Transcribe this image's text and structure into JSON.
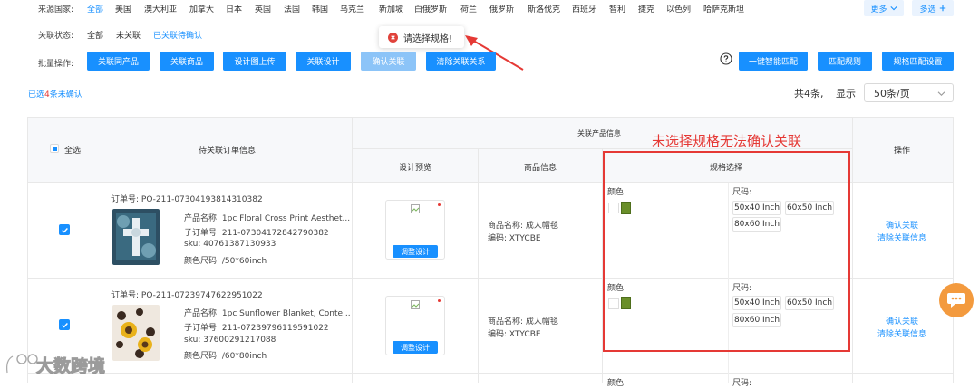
{
  "filters": {
    "country_label": "来源国家:",
    "countries": [
      {
        "label": "全部",
        "active": true
      },
      {
        "label": "美国",
        "active": false
      },
      {
        "label": "澳大利亚",
        "active": false
      },
      {
        "label": "加拿大",
        "active": false
      },
      {
        "label": "日本",
        "active": false
      },
      {
        "label": "英国",
        "active": false
      },
      {
        "label": "法国",
        "active": false
      },
      {
        "label": "韩国",
        "active": false
      },
      {
        "label": "乌克兰",
        "active": false
      },
      {
        "label": "新加坡",
        "active": false
      },
      {
        "label": "白俄罗斯",
        "active": false
      },
      {
        "label": "荷兰",
        "active": false
      },
      {
        "label": "俄罗斯",
        "active": false
      },
      {
        "label": "斯洛伐克",
        "active": false
      },
      {
        "label": "西班牙",
        "active": false
      },
      {
        "label": "智利",
        "active": false
      },
      {
        "label": "捷克",
        "active": false
      },
      {
        "label": "以色列",
        "active": false
      },
      {
        "label": "哈萨克斯坦",
        "active": false
      }
    ],
    "more_label": "更多",
    "multi_label": "多选",
    "status_label": "关联状态:",
    "statuses": [
      {
        "label": "全部",
        "active": false
      },
      {
        "label": "未关联",
        "active": false
      },
      {
        "label": "已关联待确认",
        "active": true
      }
    ]
  },
  "toast": {
    "message": "请选择规格!"
  },
  "batch": {
    "label": "批量操作:",
    "buttons": [
      "关联同产品",
      "关联商品",
      "设计图上传",
      "关联设计",
      "确认关联",
      "清除关联关系"
    ],
    "right_buttons": [
      "一键智能匹配",
      "匹配规则",
      "规格匹配设置"
    ]
  },
  "selection": {
    "prefix": "已选",
    "count": "4",
    "suffix": "条未确认"
  },
  "pagination": {
    "total_text": "共4条,",
    "display_label": "显示",
    "page_size": "50条/页"
  },
  "annotation": {
    "text": "未选择规格无法确认关联",
    "color": "#e53935"
  },
  "table": {
    "select_all": "全选",
    "col_order": "待关联订单信息",
    "col_related": "关联产品信息",
    "col_preview": "设计预览",
    "col_product": "商品信息",
    "col_spec": "规格选择",
    "col_ops": "操作",
    "rows": [
      {
        "order_no": "订单号: PO-211-07304193814310382",
        "product_name": "产品名称: 1pc Floral Cross Print Aesthet...",
        "sub_order": "子订单号: 211-07304172842790382",
        "sku": "sku: 40761387130933",
        "color_size": "颜色尺码: /50*60inch",
        "adjust_label": "调整设计",
        "goods_name": "商品名称: 成人帽毯",
        "goods_code": "编码: XTYCBE",
        "color_label": "颜色:",
        "size_label": "尺码:",
        "sizes": [
          "50x40 Inch",
          "60x50 Inch",
          "80x60 Inch"
        ],
        "op_confirm": "确认关联",
        "op_clear": "清除关联信息"
      },
      {
        "order_no": "订单号: PO-211-07239747622951022",
        "product_name": "产品名称: 1pc Sunflower Blanket, Conte...",
        "sub_order": "子订单号: 211-07239796119591022",
        "sku": "sku: 37600291217088",
        "color_size": "颜色尺码: /60*80inch",
        "adjust_label": "调整设计",
        "goods_name": "商品名称: 成人帽毯",
        "goods_code": "编码: XTYCBE",
        "color_label": "颜色:",
        "size_label": "尺码:",
        "sizes": [
          "50x40 Inch",
          "60x50 Inch",
          "80x60 Inch"
        ],
        "op_confirm": "确认关联",
        "op_clear": "清除关联信息"
      }
    ],
    "partial_row": {
      "color_label": "颜色:",
      "size_label": "尺码:"
    }
  },
  "watermark": {
    "text": "大数跨境"
  },
  "icons": {
    "close_circle": "close-circle-icon",
    "help": "help-circle-icon",
    "chat": "chat-bubble-icon",
    "check": "check-icon",
    "chevron": "chevron-down-icon",
    "plus": "plus-icon"
  }
}
